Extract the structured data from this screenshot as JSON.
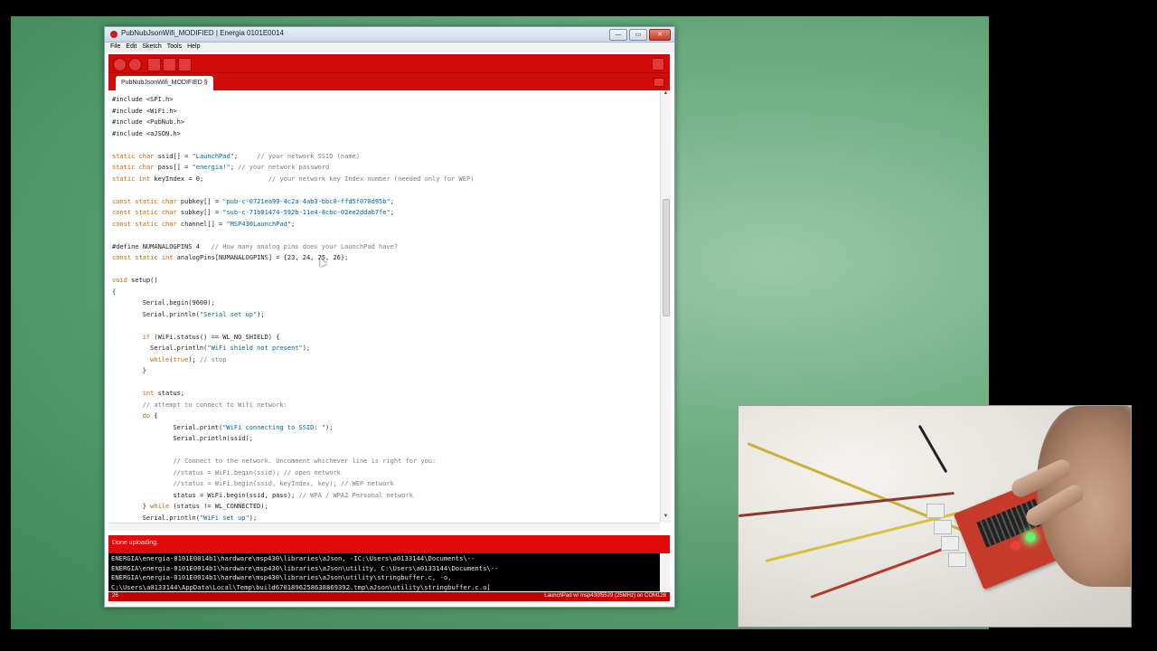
{
  "window": {
    "title": "PubNubJsonWifi_MODIFIED | Energia 0101E0014",
    "controls": {
      "minimize": "—",
      "maximize": "▭",
      "close": "✕"
    }
  },
  "menu": [
    "File",
    "Edit",
    "Sketch",
    "Tools",
    "Help"
  ],
  "toolbar": {
    "icons": [
      "verify-icon",
      "upload-icon",
      "new-icon",
      "open-icon",
      "save-icon",
      "serial-monitor-icon"
    ]
  },
  "tab": {
    "label": "PubNubJsonWifi_MODIFIED §"
  },
  "editor": {
    "lines": [
      "#include <SPI.h>",
      "#include <WiFi.h>",
      "#include <PubNub.h>",
      "#include <aJSON.h>",
      "",
      "static char ssid[] = \"LaunchPad\";     // your network SSID (name)",
      "static char pass[] = \"energia!\"; // your network password",
      "static int keyIndex = 0;                 // your network key Index number (needed only for WEP)",
      "",
      "const static char pubkey[] = \"pub-c-0721ea99-4c2a-4ab3-bbc0-ffd5f070d95b\";",
      "const static char subkey[] = \"sub-c-71b01474-592b-11e4-8cbc-02ee2ddab7fe\";",
      "const static char channel[] = \"MSP430LaunchPad\";",
      "",
      "#define NUMANALOGPINS 4   // How many analog pins does your LaunchPad have?",
      "const static int analogPins[NUMANALOGPINS] = {23, 24, 25, 26};",
      "",
      "void setup()",
      "{",
      "        Serial.begin(9600);",
      "        Serial.println(\"Serial set up\");",
      "",
      "        if (WiFi.status() == WL_NO_SHIELD) {",
      "          Serial.println(\"WiFi shield not present\");",
      "          while(true); // stop",
      "        }",
      "",
      "        int status;",
      "        // attempt to connect to Wifi network:",
      "        do {",
      "                Serial.print(\"WiFi connecting to SSID: \");",
      "                Serial.println(ssid);",
      "",
      "                // Connect to the network. Uncomment whichever line is right for you:",
      "                //status = WiFi.begin(ssid); // open network",
      "                //status = WiFi.begin(ssid, keyIndex, key); // WEP network",
      "                status = WiFi.begin(ssid, pass); // WPA / WPA2 Personal network",
      "        } while (status != WL_CONNECTED);",
      "        Serial.println(\"WiFi set up\");"
    ]
  },
  "status": {
    "message": "Done uploading."
  },
  "console": {
    "lines": [
      "ENERGIA\\energia-0101E0014b1\\hardware\\msp430\\libraries\\aJson, -IC:\\Users\\a0133144\\Documents\\--",
      "ENERGIA\\energia-0101E0014b1\\hardware\\msp430\\libraries\\aJson\\utility, C:\\Users\\a0133144\\Documents\\--",
      "ENERGIA\\energia-0101E0014b1\\hardware\\msp430\\libraries\\aJson\\utility\\stringbuffer.c, -o,",
      "C:\\Users\\a0133144\\AppData\\Local\\Temp\\build6701896258638869392.tmp\\aJson\\utility\\stringbuffer.c.o]"
    ]
  },
  "footer": {
    "line_number": "26",
    "board": "LaunchPad w/ msp430f5529 (25MHz) on COM128"
  },
  "colors": {
    "toolbar": "#d10a0a",
    "keyword": "#cc6600",
    "type": "#cc6600",
    "string": "#006699",
    "comment": "#7e7e7e"
  }
}
